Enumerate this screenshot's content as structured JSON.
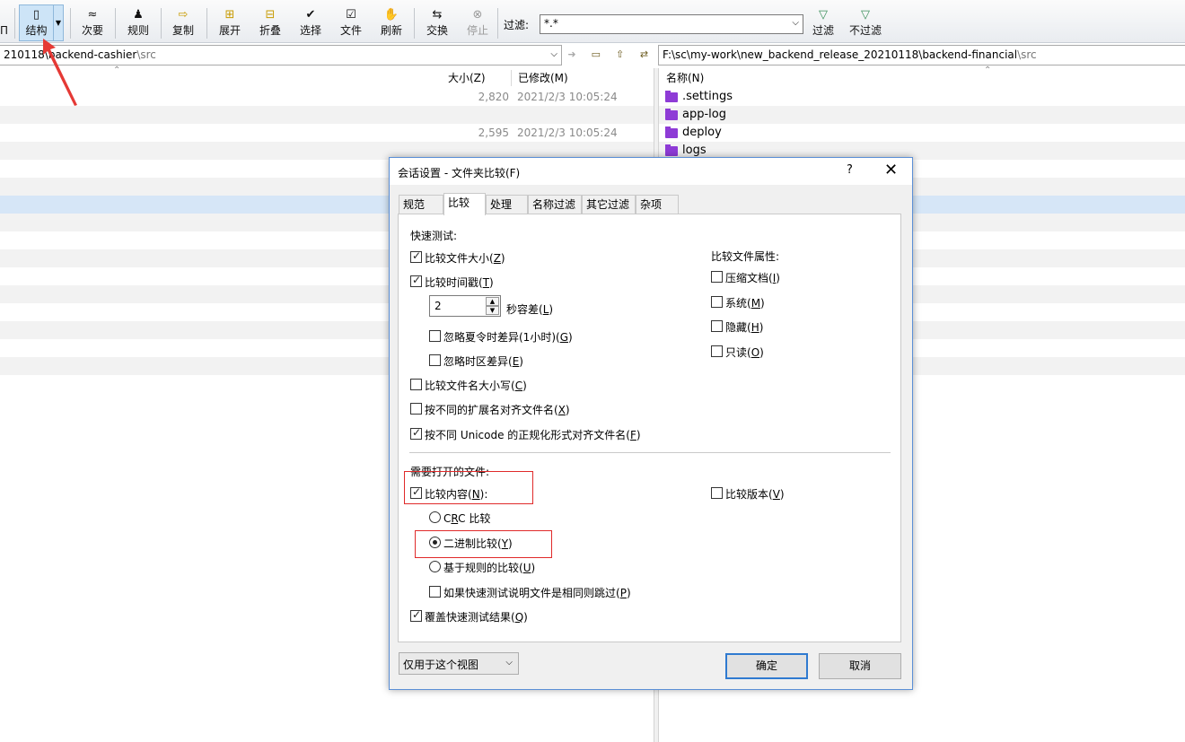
{
  "toolbar": {
    "items": [
      {
        "label": "结构",
        "icon": "structure-icon"
      },
      {
        "label": "次要",
        "icon": "minor-icon"
      },
      {
        "label": "规则",
        "icon": "rules-icon"
      },
      {
        "label": "复制",
        "icon": "copy-icon"
      },
      {
        "label": "展开",
        "icon": "expand-icon"
      },
      {
        "label": "折叠",
        "icon": "collapse-icon"
      },
      {
        "label": "选择",
        "icon": "select-icon"
      },
      {
        "label": "文件",
        "icon": "file-icon"
      },
      {
        "label": "刷新",
        "icon": "refresh-icon"
      },
      {
        "label": "交换",
        "icon": "swap-icon"
      },
      {
        "label": "停止",
        "icon": "stop-icon"
      },
      {
        "label": "过滤",
        "icon": "filter-icon"
      },
      {
        "label": "不过滤",
        "icon": "no-filter-icon"
      }
    ],
    "filter_label": "过滤:",
    "filter_value": "*.*"
  },
  "left_path": {
    "prefix": "210118\\b",
    "main": "ackend-cashier",
    "suffix": "\\src"
  },
  "right_path": {
    "main": "F:\\sc\\my-work\\new_backend_release_20210118\\backend-financial",
    "suffix": "\\src"
  },
  "left_pane": {
    "col_size": "大小(Z)",
    "col_modified": "已修改(M)",
    "rows": [
      {
        "size": "2,820",
        "modified": "2021/2/3 10:05:24"
      },
      {
        "size": "",
        "modified": ""
      },
      {
        "size": "2,595",
        "modified": "2021/2/3 10:05:24"
      }
    ]
  },
  "right_pane": {
    "col_name": "名称(N)",
    "folders": [
      ".settings",
      "app-log",
      "deploy",
      "logs"
    ]
  },
  "dialog": {
    "title": "会话设置 - 文件夹比较(F)",
    "help": "?",
    "close": "✕",
    "tabs": [
      "规范",
      "比较",
      "处理",
      "名称过滤",
      "其它过滤",
      "杂项"
    ],
    "quick_test_heading": "快速测试:",
    "compare_size": {
      "text": "比较文件大小(",
      "key": "Z",
      "end": ")",
      "checked": true
    },
    "compare_time": {
      "text": "比较时间戳(",
      "key": "T",
      "end": ")",
      "checked": true
    },
    "tolerance_value": "2",
    "tolerance_label": {
      "text": "秒容差(",
      "key": "L",
      "end": ")"
    },
    "ignore_dst": {
      "text": "忽略夏令时差异(1小时)(",
      "key": "G",
      "end": ")",
      "checked": false
    },
    "ignore_tz": {
      "text": "忽略时区差异(",
      "key": "E",
      "end": ")",
      "checked": false
    },
    "compare_case": {
      "text": "比较文件名大小写(",
      "key": "C",
      "end": ")",
      "checked": false
    },
    "align_ext": {
      "text": "按不同的扩展名对齐文件名(",
      "key": "X",
      "end": ")",
      "checked": false
    },
    "align_unicode": {
      "text": "按不同 Unicode 的正规化形式对齐文件名(",
      "key": "F",
      "end": ")",
      "checked": true
    },
    "attrs_heading": "比较文件属性:",
    "attr_archive": {
      "text": "压缩文档(",
      "key": "I",
      "end": ")",
      "checked": false
    },
    "attr_system": {
      "text": "系统(",
      "key": "M",
      "end": ")",
      "checked": false
    },
    "attr_hidden": {
      "text": "隐藏(",
      "key": "H",
      "end": ")",
      "checked": false
    },
    "attr_readonly": {
      "text": "只读(",
      "key": "O",
      "end": ")",
      "checked": false
    },
    "open_files_heading": "需要打开的文件:",
    "compare_content": {
      "text": "比较内容(",
      "key": "N",
      "end": "):",
      "checked": true
    },
    "compare_version": {
      "text": "比较版本(",
      "key": "V",
      "end": ")",
      "checked": false
    },
    "crc": {
      "pre": "C",
      "key": "R",
      "post": "C 比较",
      "selected": false
    },
    "binary": {
      "text": "二进制比较(",
      "key": "Y",
      "end": ")",
      "selected": true
    },
    "rules_based": {
      "text": "基于规则的比较(",
      "key": "U",
      "end": ")",
      "selected": false
    },
    "skip_same": {
      "text": "如果快速测试说明文件是相同则跳过(",
      "key": "P",
      "end": ")",
      "checked": false
    },
    "override_quick": {
      "text": "覆盖快速测试结果(",
      "key": "Q",
      "end": ")",
      "checked": true
    },
    "scope_select": "仅用于这个视图",
    "ok": "确定",
    "cancel": "取消"
  },
  "colors": {
    "highlight": "#e02a2a",
    "arrow": "#e53935",
    "folder": "#8e3bd6",
    "selection": "#d6e6f7"
  }
}
